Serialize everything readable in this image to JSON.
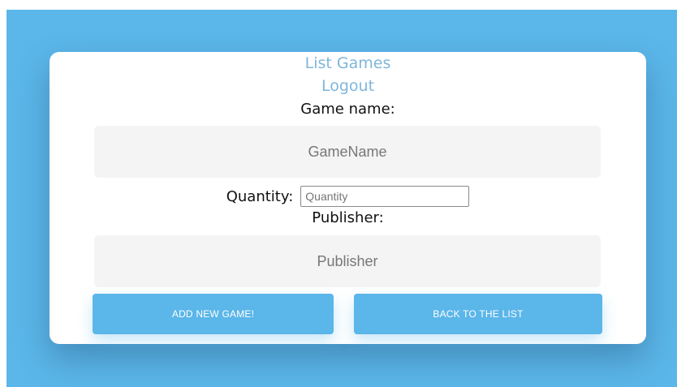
{
  "nav": {
    "list_games": "List Games",
    "logout": "Logout"
  },
  "form": {
    "game_name_label": "Game name:",
    "game_name_placeholder": "GameName",
    "quantity_label": "Quantity:",
    "quantity_placeholder": "Quantity",
    "publisher_label": "Publisher:",
    "publisher_placeholder": "Publisher"
  },
  "actions": {
    "add_label": "ADD NEW GAME!",
    "back_label": "BACK TO THE LIST"
  },
  "colors": {
    "background": "#5bb6e9",
    "link": "#7fb6dc",
    "button": "#5bb6e9"
  }
}
